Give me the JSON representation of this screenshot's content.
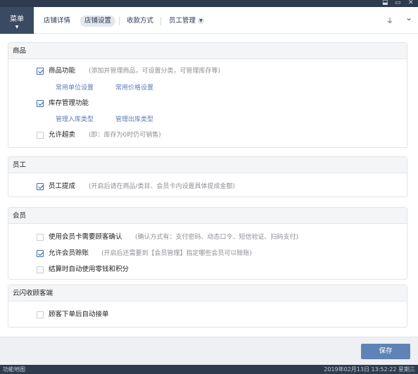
{
  "menu": {
    "label": "菜单",
    "caret": "▼"
  },
  "tabs": [
    "店铺详情",
    "店铺设置",
    "收款方式",
    "员工管理"
  ],
  "window_icons": {
    "pin": "⬓",
    "restore": "▭",
    "close": "✕"
  },
  "header_icons": {
    "chart": "⏚",
    "chevron": "⌄"
  },
  "sections": {
    "goods": {
      "title": "商品",
      "goods_feature": {
        "label": "商品功能",
        "hint": "(添加并管理商品，可设置分类，可管理库存等)",
        "checked": true
      },
      "goods_links": [
        "常用单位设置",
        "常用价格设置"
      ],
      "stock_feature": {
        "label": "库存管理功能",
        "checked": true
      },
      "stock_links": [
        "管理入库类型",
        "管理出库类型"
      ],
      "oversell": {
        "label": "允许超卖",
        "hint": "(即：库存为0时仍可销售)",
        "checked": false
      }
    },
    "staff": {
      "title": "员工",
      "commission": {
        "label": "员工提成",
        "hint": "(开启后请在商品/类目、会员卡内设置具体提成金额)",
        "checked": true
      }
    },
    "member": {
      "title": "会员",
      "confirm": {
        "label": "使用会员卡需要顾客确认",
        "hint": "(确认方式有：支付密码、动态口令、短信验证、扫码支付)",
        "checked": false
      },
      "credit": {
        "label": "允许会员赊账",
        "hint": "(开启后还需要到【会员管理】指定哪些会员可以赊账)",
        "checked": true
      },
      "auto_points": {
        "label": "结算时自动使用零钱和积分",
        "checked": false
      }
    },
    "cloud": {
      "title": "云闪收顾客端",
      "auto_accept": {
        "label": "顾客下单后自动接单",
        "checked": false
      }
    }
  },
  "footer": {
    "save_label": "保存"
  },
  "statusbar": {
    "left": "功能地图",
    "right": "2019年02月13日 13:52:22 星期三"
  }
}
